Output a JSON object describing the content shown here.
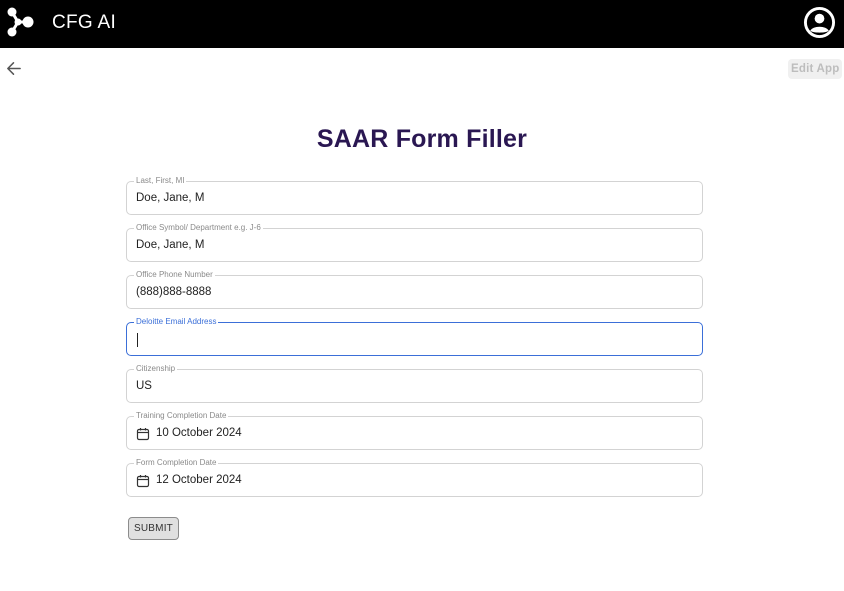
{
  "header": {
    "app_name": "CFG AI",
    "logo_icon": "hub-logo-icon",
    "account_icon": "account-circle-icon"
  },
  "toolbar": {
    "back_icon": "arrow-left-icon",
    "edit_app_label": "Edit App"
  },
  "form": {
    "title": "SAAR Form Filler",
    "fields": [
      {
        "label": "Last, First, MI",
        "value": "Doe, Jane, M"
      },
      {
        "label": "Office Symbol/ Department e.g. J-6",
        "value": "Doe, Jane, M"
      },
      {
        "label": "Office Phone Number",
        "value": "(888)888-8888"
      },
      {
        "label": "Deloitte Email Address",
        "value": ""
      },
      {
        "label": "Citizenship",
        "value": "US"
      },
      {
        "label": "Training Completion Date",
        "value": "10 October 2024",
        "icon": "calendar-icon"
      },
      {
        "label": "Form Completion Date",
        "value": "12 October 2024",
        "icon": "calendar-icon"
      }
    ],
    "submit_label": "SUBMIT"
  },
  "colors": {
    "header_bg": "#000000",
    "title": "#2a1752",
    "focus": "#3b6fd8"
  }
}
